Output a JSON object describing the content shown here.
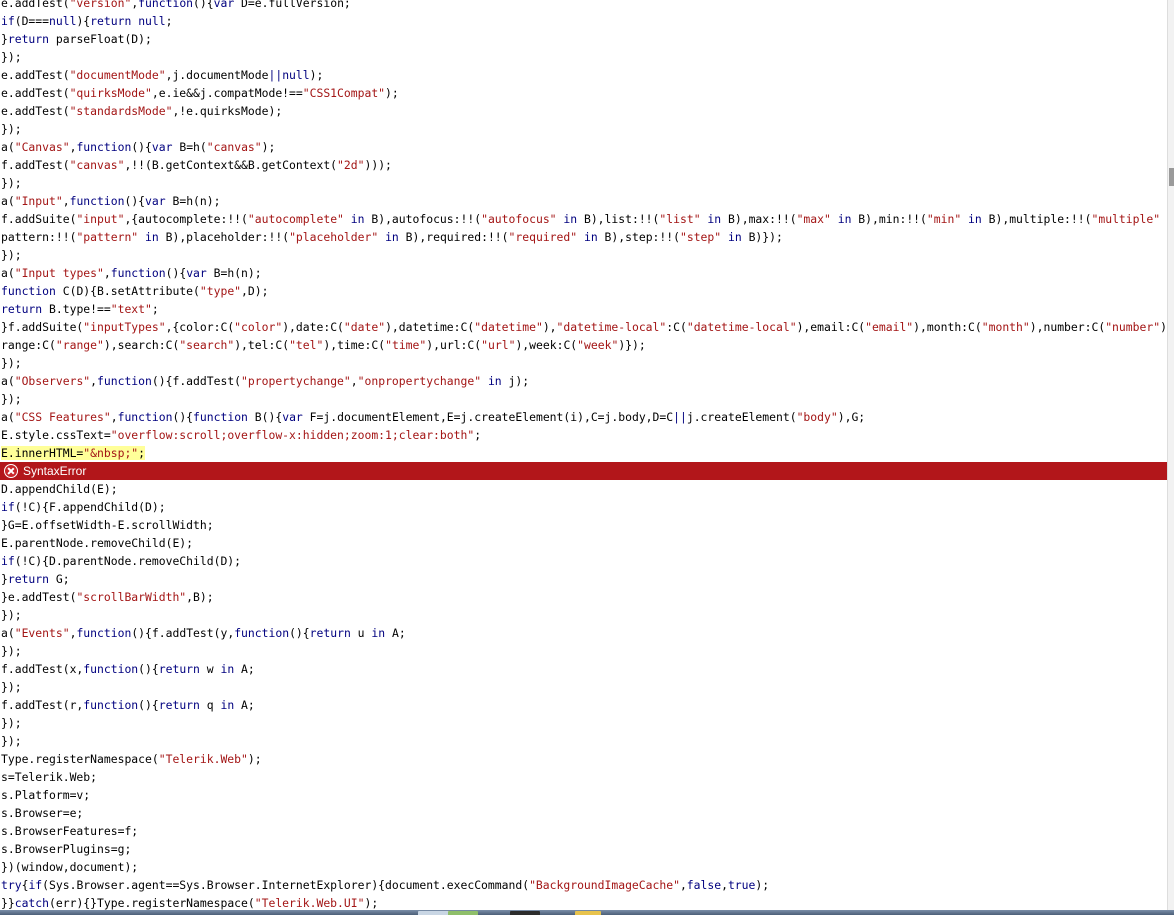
{
  "editor": {
    "lines_before_error": [
      "e.addTest(\"version\",function(){var D=e.fullVersion;",
      "if(D===null){return null;",
      "}return parseFloat(D);",
      "});",
      "e.addTest(\"documentMode\",j.documentMode||null);",
      "e.addTest(\"quirksMode\",e.ie&&j.compatMode!==\"CSS1Compat\");",
      "e.addTest(\"standardsMode\",!e.quirksMode);",
      "});",
      "a(\"Canvas\",function(){var B=h(\"canvas\");",
      "f.addTest(\"canvas\",!!(B.getContext&&B.getContext(\"2d\")));",
      "});",
      "a(\"Input\",function(){var B=h(n);",
      "f.addSuite(\"input\",{autocomplete:!!(\"autocomplete\" in B),autofocus:!!(\"autofocus\" in B),list:!!(\"list\" in B),max:!!(\"max\" in B),min:!!(\"min\" in B),multiple:!!(\"multiple\" in B),",
      "pattern:!!(\"pattern\" in B),placeholder:!!(\"placeholder\" in B),required:!!(\"required\" in B),step:!!(\"step\" in B)});",
      "});",
      "a(\"Input types\",function(){var B=h(n);",
      "function C(D){B.setAttribute(\"type\",D);",
      "return B.type!==\"text\";",
      "}f.addSuite(\"inputTypes\",{color:C(\"color\"),date:C(\"date\"),datetime:C(\"datetime\"),\"datetime-local\":C(\"datetime-local\"),email:C(\"email\"),month:C(\"month\"),number:C(\"number\"),",
      "range:C(\"range\"),search:C(\"search\"),tel:C(\"tel\"),time:C(\"time\"),url:C(\"url\"),week:C(\"week\")});",
      "});",
      "a(\"Observers\",function(){f.addTest(\"propertychange\",\"onpropertychange\" in j);",
      "});",
      "a(\"CSS Features\",function(){function B(){var F=j.documentElement,E=j.createElement(i),C=j.body,D=C||j.createElement(\"body\"),G;",
      "E.style.cssText=\"overflow:scroll;overflow-x:hidden;zoom:1;clear:both\";"
    ],
    "highlighted_line": "E.innerHTML=\"&nbsp;\";",
    "error": {
      "message": "SyntaxError",
      "icon": "error-circle-x-icon",
      "color": "#b2161a"
    },
    "lines_after_error": [
      "D.appendChild(E);",
      "if(!C){F.appendChild(D);",
      "}G=E.offsetWidth-E.scrollWidth;",
      "E.parentNode.removeChild(E);",
      "if(!C){D.parentNode.removeChild(D);",
      "}return G;",
      "}e.addTest(\"scrollBarWidth\",B);",
      "});",
      "a(\"Events\",function(){f.addTest(y,function(){return u in A;",
      "});",
      "f.addTest(x,function(){return w in A;",
      "});",
      "f.addTest(r,function(){return q in A;",
      "});",
      "});",
      "Type.registerNamespace(\"Telerik.Web\");",
      "s=Telerik.Web;",
      "s.Platform=v;",
      "s.Browser=e;",
      "s.BrowserFeatures=f;",
      "s.BrowserPlugins=g;",
      "})(window,document);",
      "try{if(Sys.Browser.agent==Sys.Browser.InternetExplorer){document.execCommand(\"BackgroundImageCache\",false,true);",
      "}}catch(err){}Type.registerNamespace(\"Telerik.Web.UI\");"
    ]
  },
  "colors": {
    "keyword": "#00007f",
    "string": "#a31515",
    "highlight": "#ffff99",
    "error_bar": "#b2161a"
  }
}
